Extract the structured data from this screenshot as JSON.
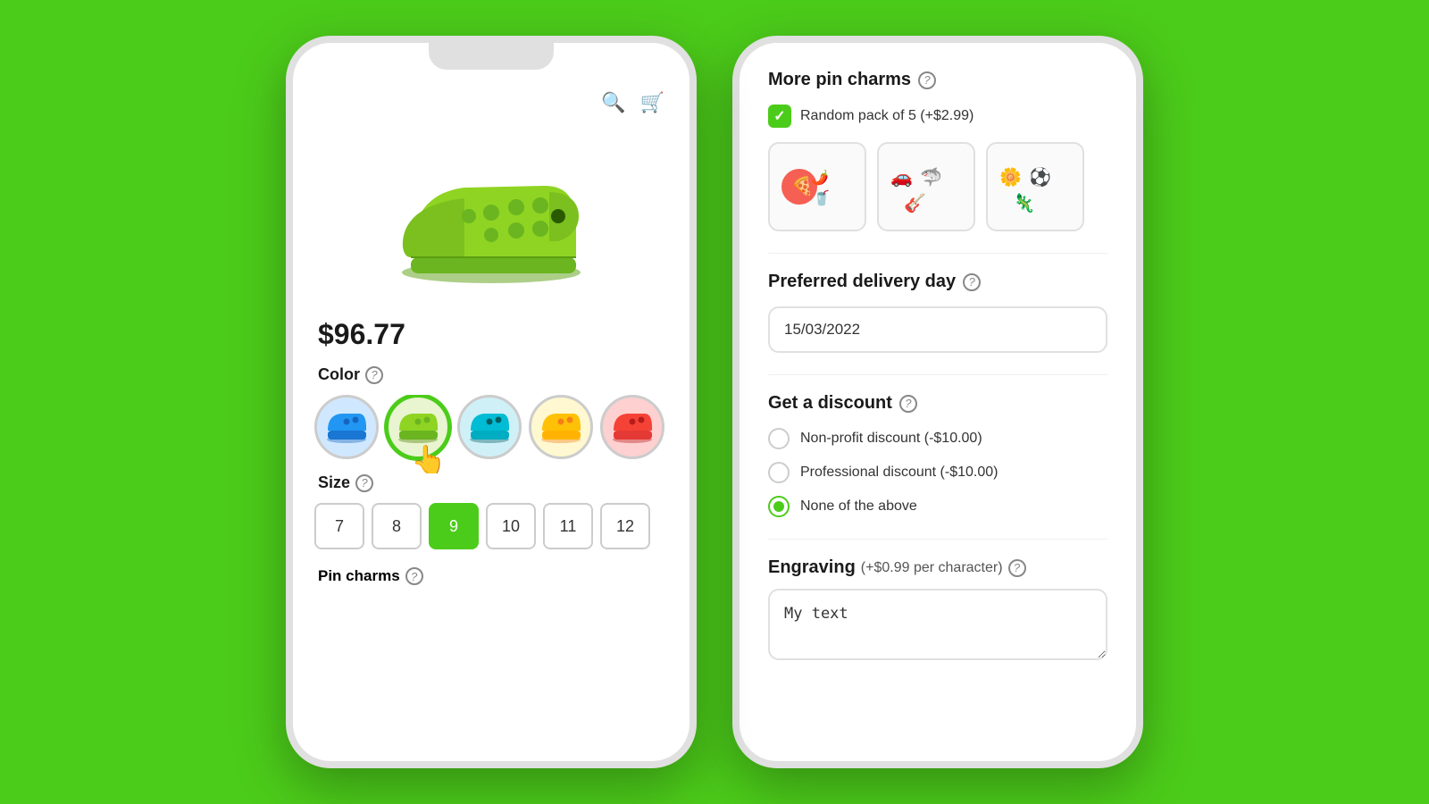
{
  "background_color": "#4ccc1a",
  "phone_left": {
    "top_icons": {
      "search": "🔍",
      "cart": "🛒"
    },
    "price": "$96.77",
    "color_section": {
      "label": "Color",
      "help": "?",
      "swatches": [
        {
          "id": "blue",
          "emoji": "👟",
          "color": "#2196F3",
          "selected": false
        },
        {
          "id": "green",
          "emoji": "🥿",
          "color": "#7bc043",
          "selected": true
        },
        {
          "id": "cyan",
          "emoji": "👡",
          "color": "#00BCD4",
          "selected": false
        },
        {
          "id": "yellow",
          "emoji": "👟",
          "color": "#FFC107",
          "selected": false
        },
        {
          "id": "red",
          "emoji": "👡",
          "color": "#F44336",
          "selected": false
        }
      ]
    },
    "size_section": {
      "label": "Size",
      "help": "?",
      "sizes": [
        {
          "value": "7",
          "selected": false
        },
        {
          "value": "8",
          "selected": false
        },
        {
          "value": "9",
          "selected": true
        },
        {
          "value": "10",
          "selected": false
        },
        {
          "value": "11",
          "selected": false
        },
        {
          "value": "12",
          "selected": false
        }
      ]
    },
    "pin_charms_section": {
      "label": "Pin charms",
      "help": "?"
    }
  },
  "panel_right": {
    "more_pin_charms": {
      "title": "More pin charms",
      "help": "?",
      "checkbox_label": "Random pack of 5 (+$2.99)",
      "checkbox_checked": true,
      "charms": [
        {
          "id": "food",
          "emojis": "🍕🌶️🥤"
        },
        {
          "id": "vehicles",
          "emojis": "🚗🦈🎸"
        },
        {
          "id": "misc",
          "emojis": "🌼⚽🦎"
        }
      ]
    },
    "preferred_delivery": {
      "title": "Preferred delivery day",
      "help": "?",
      "value": "15/03/2022"
    },
    "get_discount": {
      "title": "Get a discount",
      "help": "?",
      "options": [
        {
          "id": "nonprofit",
          "label": "Non-profit discount (-$10.00)",
          "selected": false
        },
        {
          "id": "professional",
          "label": "Professional discount (-$10.00)",
          "selected": false
        },
        {
          "id": "none",
          "label": "None of the above",
          "selected": true
        }
      ]
    },
    "engraving": {
      "title": "Engraving",
      "subtitle": "(+$0.99 per character)",
      "help": "?",
      "value": "My text"
    }
  }
}
